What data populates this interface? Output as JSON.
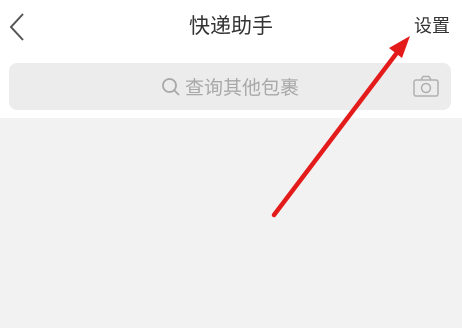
{
  "header": {
    "title": "快递助手",
    "settings_label": "设置"
  },
  "search": {
    "placeholder": "查询其他包裹"
  },
  "icons": {
    "back": "chevron-left-icon",
    "search": "search-icon",
    "camera": "camera-icon"
  },
  "colors": {
    "annotation_arrow": "#e31b1b",
    "background": "#f2f2f2",
    "search_bg": "#ececec"
  }
}
